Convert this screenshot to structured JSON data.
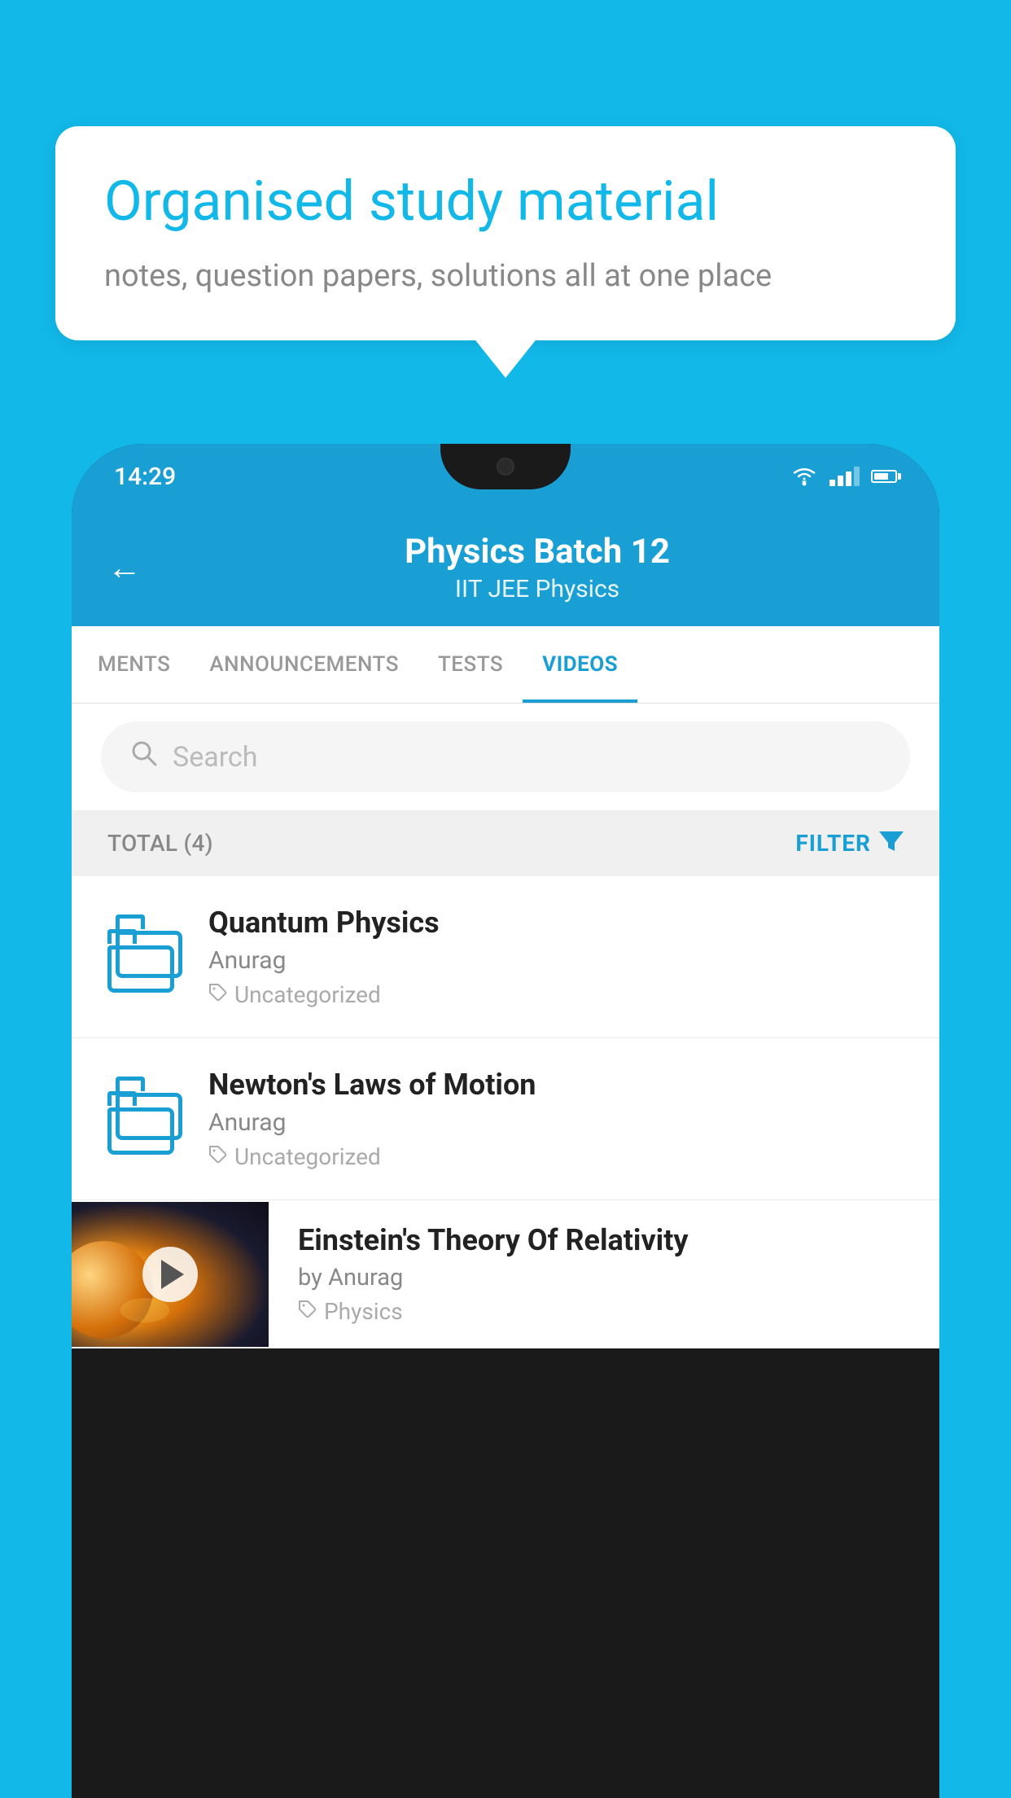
{
  "background_color": "#12b8e8",
  "speech_bubble": {
    "title": "Organised study material",
    "subtitle": "notes, question papers, solutions all at one place"
  },
  "phone": {
    "status_bar": {
      "time": "14:29"
    },
    "header": {
      "title": "Physics Batch 12",
      "subtitle": "IIT JEE    Physics",
      "back_label": "←"
    },
    "tabs": [
      {
        "label": "MENTS",
        "active": false
      },
      {
        "label": "ANNOUNCEMENTS",
        "active": false
      },
      {
        "label": "TESTS",
        "active": false
      },
      {
        "label": "VIDEOS",
        "active": true
      }
    ],
    "search": {
      "placeholder": "Search"
    },
    "filter_bar": {
      "total_label": "TOTAL (4)",
      "filter_label": "FILTER"
    },
    "videos": [
      {
        "title": "Quantum Physics",
        "author": "Anurag",
        "tag": "Uncategorized",
        "has_thumbnail": false
      },
      {
        "title": "Newton's Laws of Motion",
        "author": "Anurag",
        "tag": "Uncategorized",
        "has_thumbnail": false
      },
      {
        "title": "Einstein's Theory Of Relativity",
        "author": "by Anurag",
        "tag": "Physics",
        "has_thumbnail": true
      }
    ]
  }
}
